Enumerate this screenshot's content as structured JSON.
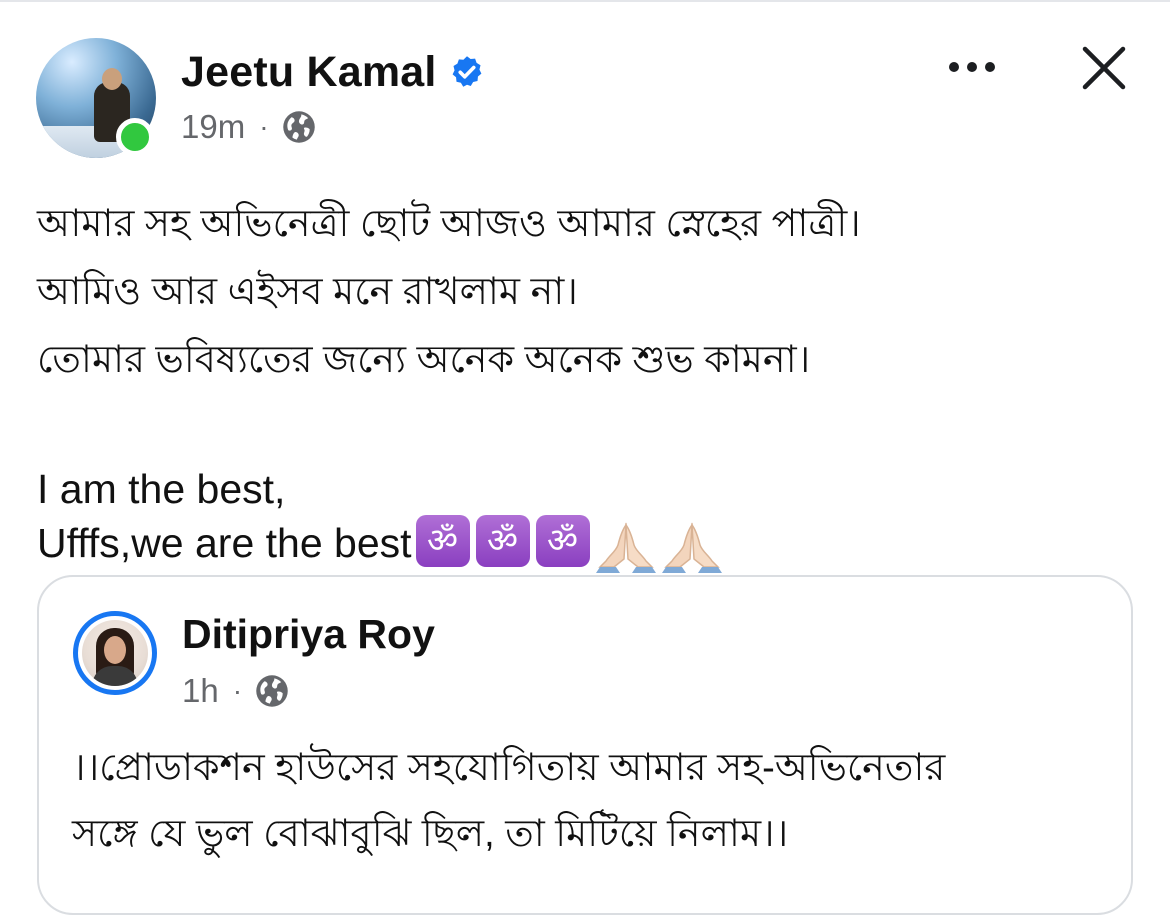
{
  "post": {
    "author_name": "Jeetu Kamal",
    "time": "19m",
    "separator": "·",
    "verified_icon": "verified-badge-icon",
    "privacy_icon": "globe-icon",
    "lines_bn": [
      "আমার সহ অভিনেত্রী ছোট আজও আমার স্নেহের পাত্রী।",
      "আমিও আর এইসব মনে রাখলাম না।",
      "তোমার ভবিষ্যতের জন্যে অনেক অনেক শুভ কামনা।"
    ],
    "lines_en": [
      "I am the best,",
      "Ufffs,we are the best"
    ],
    "emojis": {
      "om": "ॐ",
      "om_count": 3,
      "praying_hands_count": 2
    }
  },
  "actions": {
    "more_icon": "more-dots-icon",
    "close_icon": "close-icon"
  },
  "shared_post": {
    "author_name": "Ditipriya Roy",
    "time": "1h",
    "separator": "·",
    "privacy_icon": "globe-icon",
    "lines": [
      "।।প্রোডাকশন হাউসের সহযোগিতায় আমার সহ-অভিনেতার",
      "সঙ্গে যে ভুল বোঝাবুঝি ছিল, তা মিটিয়ে নিলাম।।"
    ]
  },
  "colors": {
    "verified_blue": "#1877f2",
    "online_green": "#31c83f",
    "meta_gray": "#65676b",
    "om_purple": "#9b52cb"
  }
}
